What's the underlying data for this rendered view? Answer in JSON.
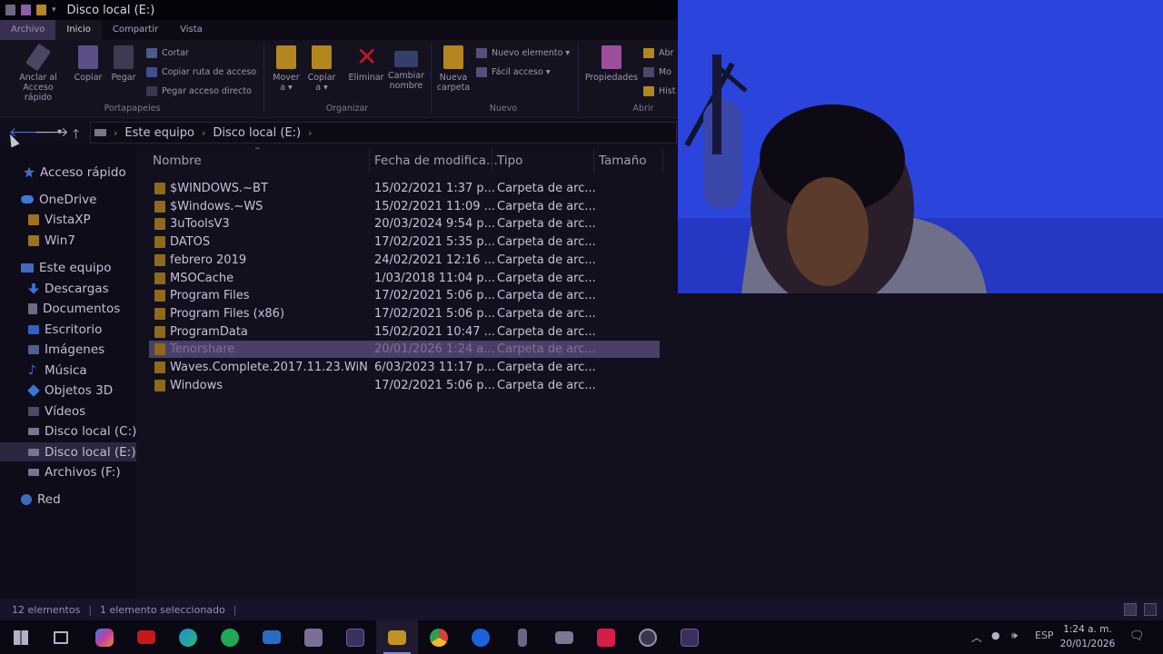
{
  "window": {
    "title": "Disco local (E:)"
  },
  "ribbon": {
    "tabs": [
      "Archivo",
      "Inicio",
      "Compartir",
      "Vista"
    ],
    "buttons": {
      "pin_line1": "Anclar al",
      "pin_line2": "Acceso rápido",
      "copy": "Copiar",
      "paste": "Pegar",
      "cut": "Cortar",
      "copy_path": "Copiar ruta de acceso",
      "paste_shortcut": "Pegar acceso directo",
      "move_line1": "Mover",
      "move_line2": "a ▾",
      "copyto_line1": "Copiar",
      "copyto_line2": "a ▾",
      "delete": "Eliminar",
      "rename_line1": "Cambiar",
      "rename_line2": "nombre",
      "newfolder_line1": "Nueva",
      "newfolder_line2": "carpeta",
      "new_item": "Nuevo elemento ▾",
      "easy_access": "Fácil acceso ▾",
      "properties": "Propiedades",
      "open": "Abr",
      "modify": "Mo",
      "history": "Hist"
    },
    "groups": {
      "clipboard": "Portapapeles",
      "organize": "Organizar",
      "new": "Nuevo",
      "open": "Abrir"
    }
  },
  "address": {
    "segments": [
      "Este equipo",
      "Disco local (E:)"
    ]
  },
  "sidebar": {
    "items": [
      {
        "label": "Acceso rápido",
        "icon": "star-icon"
      },
      {
        "label": "OneDrive",
        "icon": "cloud-icon"
      },
      {
        "label": "VistaXP",
        "icon": "folder-icon"
      },
      {
        "label": "Win7",
        "icon": "folder-icon"
      },
      {
        "label": "Este equipo",
        "icon": "computer-icon"
      },
      {
        "label": "Descargas",
        "icon": "download-icon"
      },
      {
        "label": "Documentos",
        "icon": "document-icon"
      },
      {
        "label": "Escritorio",
        "icon": "desktop-icon"
      },
      {
        "label": "Imágenes",
        "icon": "image-icon"
      },
      {
        "label": "Música",
        "icon": "music-icon"
      },
      {
        "label": "Objetos 3D",
        "icon": "cube-icon"
      },
      {
        "label": "Vídeos",
        "icon": "video-icon"
      },
      {
        "label": "Disco local (C:)",
        "icon": "drive-icon"
      },
      {
        "label": "Disco local (E:)",
        "icon": "drive-icon"
      },
      {
        "label": "Archivos (F:)",
        "icon": "drive-icon"
      },
      {
        "label": "Red",
        "icon": "network-icon"
      }
    ]
  },
  "columns": {
    "name": "Nombre",
    "date": "Fecha de modifica...",
    "type": "Tipo",
    "size": "Tamaño"
  },
  "files": [
    {
      "name": "$WINDOWS.~BT",
      "date": "15/02/2021 1:37 p...",
      "type": "Carpeta de arc..."
    },
    {
      "name": "$Windows.~WS",
      "date": "15/02/2021 11:09 ...",
      "type": "Carpeta de arc..."
    },
    {
      "name": "3uToolsV3",
      "date": "20/03/2024 9:54 p...",
      "type": "Carpeta de arc..."
    },
    {
      "name": "DATOS",
      "date": "17/02/2021 5:35 p...",
      "type": "Carpeta de arc..."
    },
    {
      "name": "febrero 2019",
      "date": "24/02/2021 12:16 ...",
      "type": "Carpeta de arc..."
    },
    {
      "name": "MSOCache",
      "date": "1/03/2018 11:04 p...",
      "type": "Carpeta de arc..."
    },
    {
      "name": "Program Files",
      "date": "17/02/2021 5:06 p...",
      "type": "Carpeta de arc..."
    },
    {
      "name": "Program Files (x86)",
      "date": "17/02/2021 5:06 p...",
      "type": "Carpeta de arc..."
    },
    {
      "name": "ProgramData",
      "date": "15/02/2021 10:47 ...",
      "type": "Carpeta de arc..."
    },
    {
      "name": "Tenorshare",
      "date": "20/01/2026 1:24 a...",
      "type": "Carpeta de arc..."
    },
    {
      "name": "Waves.Complete.2017.11.23.WiN",
      "date": "6/03/2023 11:17 p...",
      "type": "Carpeta de arc..."
    },
    {
      "name": "Windows",
      "date": "17/02/2021 5:06 p...",
      "type": "Carpeta de arc..."
    }
  ],
  "status": {
    "count": "12 elementos",
    "selection": "1 elemento seleccionado"
  },
  "taskbar": {
    "language": "ESP",
    "time": "1:24 a. m.",
    "date": "20/01/2026"
  },
  "colors": {
    "folder": "#8e6a1c",
    "selected_row": "#4a3f66",
    "webcam_bg": "#2b43dc"
  }
}
